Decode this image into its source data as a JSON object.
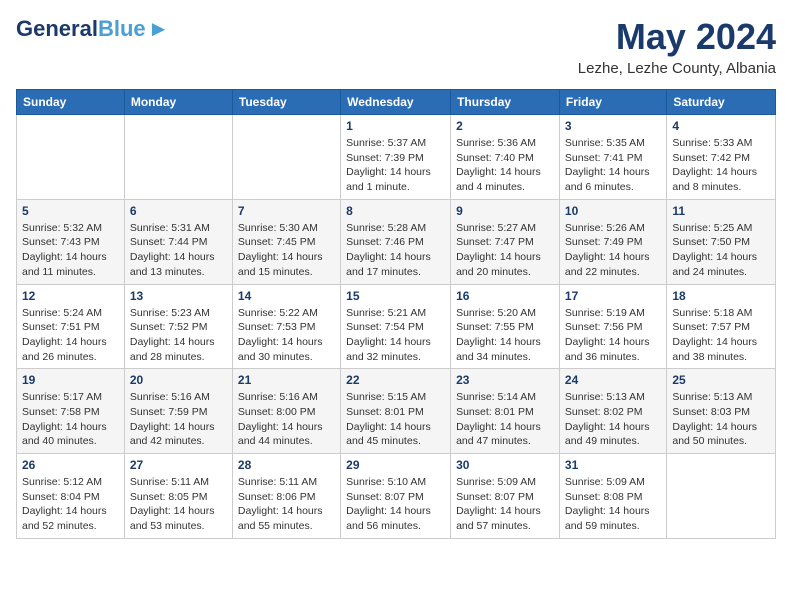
{
  "header": {
    "logo_general": "General",
    "logo_blue": "Blue",
    "month": "May 2024",
    "location": "Lezhe, Lezhe County, Albania"
  },
  "days_of_week": [
    "Sunday",
    "Monday",
    "Tuesday",
    "Wednesday",
    "Thursday",
    "Friday",
    "Saturday"
  ],
  "weeks": [
    [
      {
        "num": "",
        "info": ""
      },
      {
        "num": "",
        "info": ""
      },
      {
        "num": "",
        "info": ""
      },
      {
        "num": "1",
        "info": "Sunrise: 5:37 AM\nSunset: 7:39 PM\nDaylight: 14 hours\nand 1 minute."
      },
      {
        "num": "2",
        "info": "Sunrise: 5:36 AM\nSunset: 7:40 PM\nDaylight: 14 hours\nand 4 minutes."
      },
      {
        "num": "3",
        "info": "Sunrise: 5:35 AM\nSunset: 7:41 PM\nDaylight: 14 hours\nand 6 minutes."
      },
      {
        "num": "4",
        "info": "Sunrise: 5:33 AM\nSunset: 7:42 PM\nDaylight: 14 hours\nand 8 minutes."
      }
    ],
    [
      {
        "num": "5",
        "info": "Sunrise: 5:32 AM\nSunset: 7:43 PM\nDaylight: 14 hours\nand 11 minutes."
      },
      {
        "num": "6",
        "info": "Sunrise: 5:31 AM\nSunset: 7:44 PM\nDaylight: 14 hours\nand 13 minutes."
      },
      {
        "num": "7",
        "info": "Sunrise: 5:30 AM\nSunset: 7:45 PM\nDaylight: 14 hours\nand 15 minutes."
      },
      {
        "num": "8",
        "info": "Sunrise: 5:28 AM\nSunset: 7:46 PM\nDaylight: 14 hours\nand 17 minutes."
      },
      {
        "num": "9",
        "info": "Sunrise: 5:27 AM\nSunset: 7:47 PM\nDaylight: 14 hours\nand 20 minutes."
      },
      {
        "num": "10",
        "info": "Sunrise: 5:26 AM\nSunset: 7:49 PM\nDaylight: 14 hours\nand 22 minutes."
      },
      {
        "num": "11",
        "info": "Sunrise: 5:25 AM\nSunset: 7:50 PM\nDaylight: 14 hours\nand 24 minutes."
      }
    ],
    [
      {
        "num": "12",
        "info": "Sunrise: 5:24 AM\nSunset: 7:51 PM\nDaylight: 14 hours\nand 26 minutes."
      },
      {
        "num": "13",
        "info": "Sunrise: 5:23 AM\nSunset: 7:52 PM\nDaylight: 14 hours\nand 28 minutes."
      },
      {
        "num": "14",
        "info": "Sunrise: 5:22 AM\nSunset: 7:53 PM\nDaylight: 14 hours\nand 30 minutes."
      },
      {
        "num": "15",
        "info": "Sunrise: 5:21 AM\nSunset: 7:54 PM\nDaylight: 14 hours\nand 32 minutes."
      },
      {
        "num": "16",
        "info": "Sunrise: 5:20 AM\nSunset: 7:55 PM\nDaylight: 14 hours\nand 34 minutes."
      },
      {
        "num": "17",
        "info": "Sunrise: 5:19 AM\nSunset: 7:56 PM\nDaylight: 14 hours\nand 36 minutes."
      },
      {
        "num": "18",
        "info": "Sunrise: 5:18 AM\nSunset: 7:57 PM\nDaylight: 14 hours\nand 38 minutes."
      }
    ],
    [
      {
        "num": "19",
        "info": "Sunrise: 5:17 AM\nSunset: 7:58 PM\nDaylight: 14 hours\nand 40 minutes."
      },
      {
        "num": "20",
        "info": "Sunrise: 5:16 AM\nSunset: 7:59 PM\nDaylight: 14 hours\nand 42 minutes."
      },
      {
        "num": "21",
        "info": "Sunrise: 5:16 AM\nSunset: 8:00 PM\nDaylight: 14 hours\nand 44 minutes."
      },
      {
        "num": "22",
        "info": "Sunrise: 5:15 AM\nSunset: 8:01 PM\nDaylight: 14 hours\nand 45 minutes."
      },
      {
        "num": "23",
        "info": "Sunrise: 5:14 AM\nSunset: 8:01 PM\nDaylight: 14 hours\nand 47 minutes."
      },
      {
        "num": "24",
        "info": "Sunrise: 5:13 AM\nSunset: 8:02 PM\nDaylight: 14 hours\nand 49 minutes."
      },
      {
        "num": "25",
        "info": "Sunrise: 5:13 AM\nSunset: 8:03 PM\nDaylight: 14 hours\nand 50 minutes."
      }
    ],
    [
      {
        "num": "26",
        "info": "Sunrise: 5:12 AM\nSunset: 8:04 PM\nDaylight: 14 hours\nand 52 minutes."
      },
      {
        "num": "27",
        "info": "Sunrise: 5:11 AM\nSunset: 8:05 PM\nDaylight: 14 hours\nand 53 minutes."
      },
      {
        "num": "28",
        "info": "Sunrise: 5:11 AM\nSunset: 8:06 PM\nDaylight: 14 hours\nand 55 minutes."
      },
      {
        "num": "29",
        "info": "Sunrise: 5:10 AM\nSunset: 8:07 PM\nDaylight: 14 hours\nand 56 minutes."
      },
      {
        "num": "30",
        "info": "Sunrise: 5:09 AM\nSunset: 8:07 PM\nDaylight: 14 hours\nand 57 minutes."
      },
      {
        "num": "31",
        "info": "Sunrise: 5:09 AM\nSunset: 8:08 PM\nDaylight: 14 hours\nand 59 minutes."
      },
      {
        "num": "",
        "info": ""
      }
    ]
  ]
}
